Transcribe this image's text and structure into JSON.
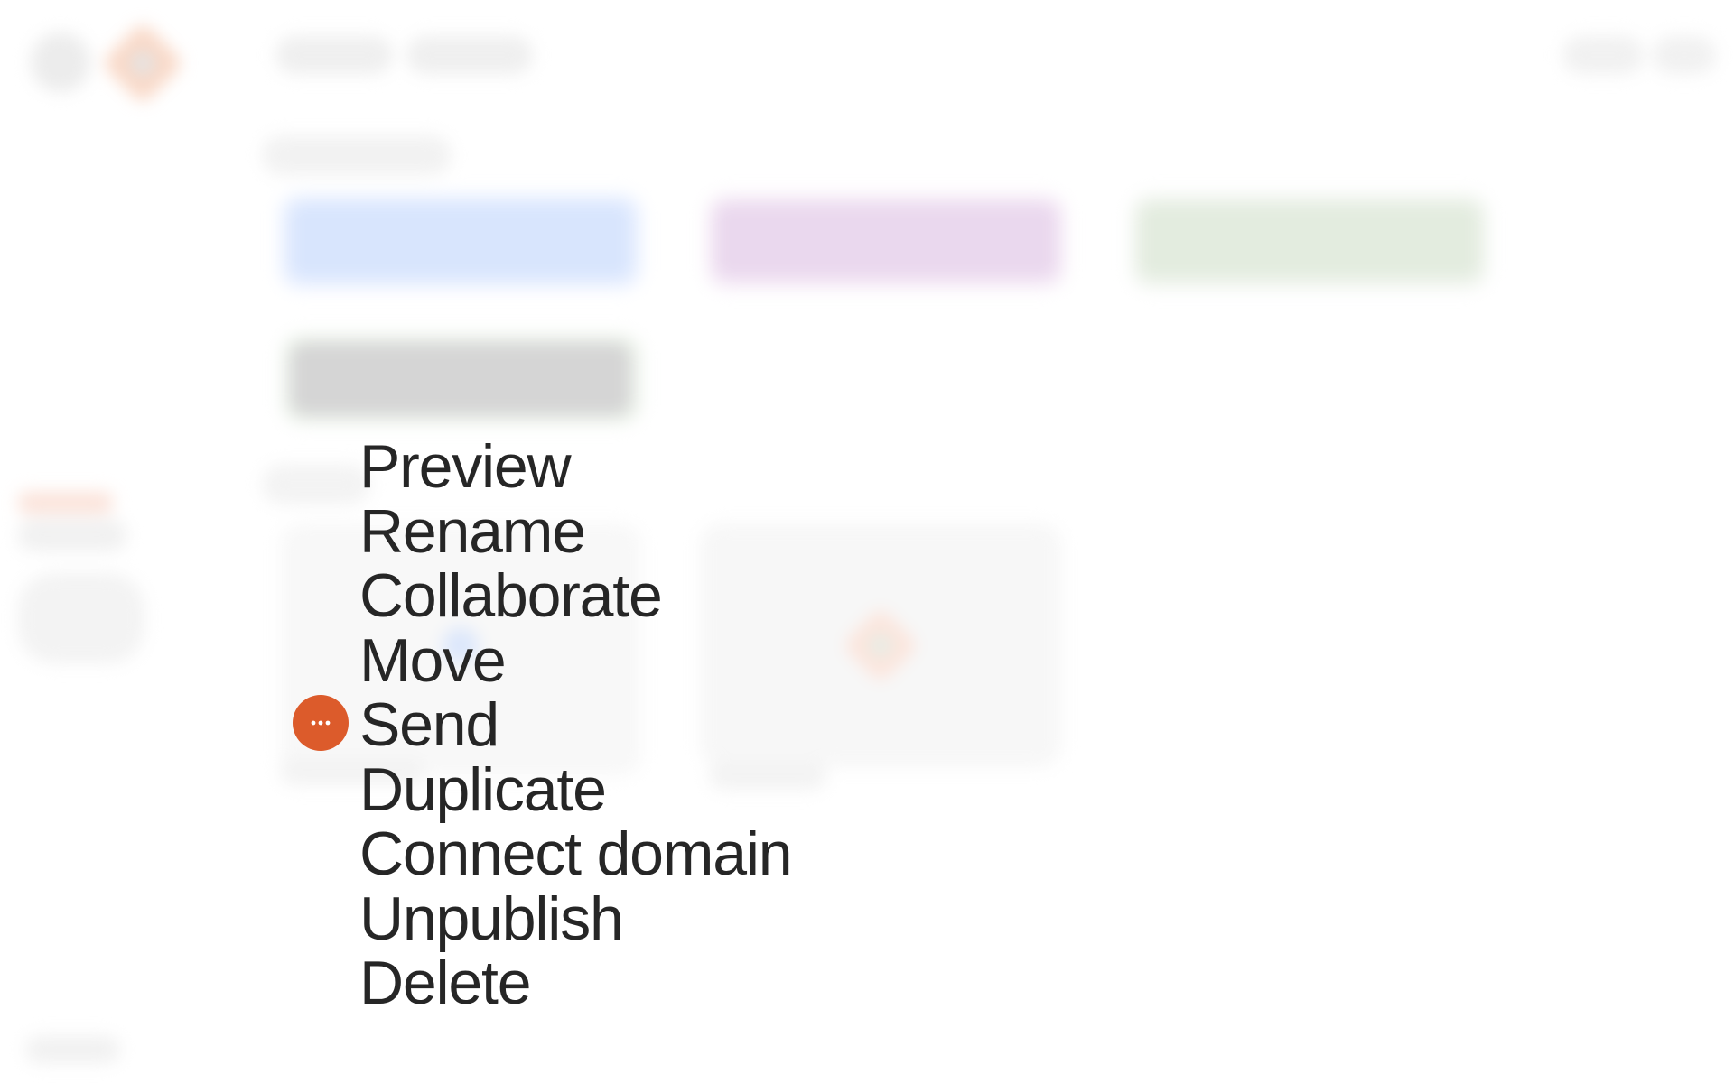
{
  "menu": {
    "trigger_icon": "more-horizontal-icon",
    "trigger_color": "#dc5b2b",
    "text_color": "#262626",
    "items": [
      {
        "label": "Preview"
      },
      {
        "label": "Rename"
      },
      {
        "label": "Collaborate"
      },
      {
        "label": "Move"
      },
      {
        "label": "Send"
      },
      {
        "label": "Duplicate"
      },
      {
        "label": "Connect domain"
      },
      {
        "label": "Unpublish"
      },
      {
        "label": "Delete"
      }
    ]
  },
  "background": {
    "state": "blurred",
    "accent_colors": {
      "brand": "#f9d9c8",
      "card_blue": "#d8e5fd",
      "card_purple": "#ead8ee",
      "card_green": "#e3ecdf",
      "card_gray": "#d5d5d5"
    }
  }
}
